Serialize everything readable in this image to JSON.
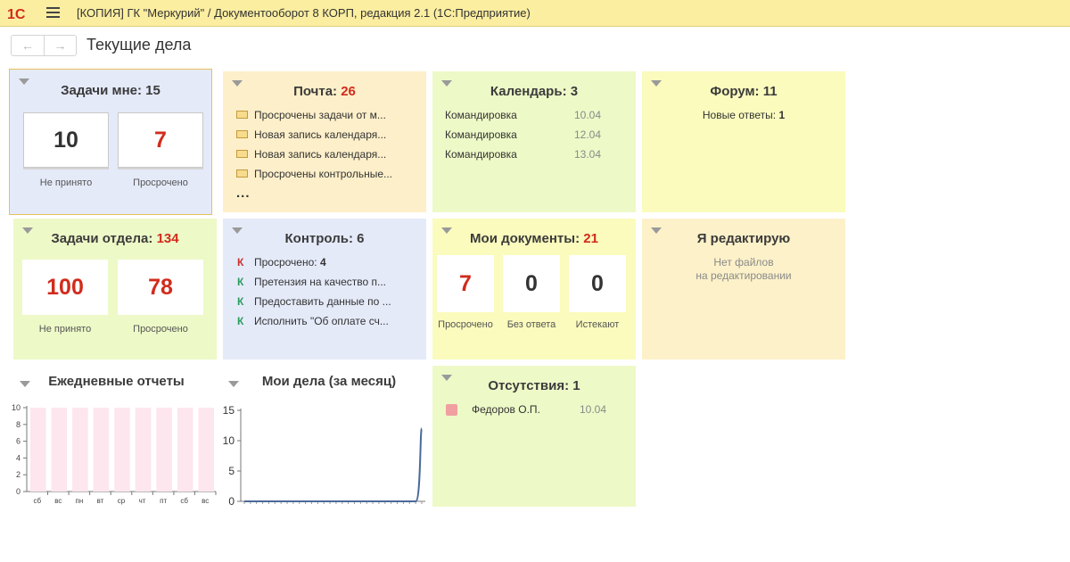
{
  "window": {
    "title": "[КОПИЯ] ГК \"Меркурий\" / Документооборот 8 КОРП, редакция 2.1  (1С:Предприятие)",
    "logo": "1С"
  },
  "page": {
    "title": "Текущие дела"
  },
  "tiles": {
    "tasks_me": {
      "title": "Задачи мне: ",
      "count": "15",
      "boxes": [
        {
          "value": "10",
          "label": "Не принято"
        },
        {
          "value": "7",
          "label": "Просрочено"
        }
      ]
    },
    "mail": {
      "title": "Почта: ",
      "count": "26",
      "items": [
        "Просрочены задачи от м...",
        "Новая запись календаря...",
        "Новая запись календаря...",
        "Просрочены контрольные..."
      ],
      "more": "..."
    },
    "calendar": {
      "title": "Календарь: 3",
      "items": [
        {
          "name": "Командировка",
          "date": "10.04"
        },
        {
          "name": "Командировка",
          "date": "12.04"
        },
        {
          "name": "Командировка",
          "date": "13.04"
        }
      ]
    },
    "forum": {
      "title": "Форум: 11",
      "label": "Новые ответы: ",
      "value": "1"
    },
    "tasks_dept": {
      "title": "Задачи отдела: ",
      "count": "134",
      "boxes": [
        {
          "value": "100",
          "label": "Не принято"
        },
        {
          "value": "78",
          "label": "Просрочено"
        }
      ]
    },
    "control": {
      "title": "Контроль: 6",
      "items": [
        {
          "mark": "К",
          "text": "Просрочено: ",
          "bold": "4",
          "color": "#c9302c"
        },
        {
          "mark": "К",
          "text": "Претензия на качество п...",
          "bold": "",
          "color": "#2a9d5c"
        },
        {
          "mark": "К",
          "text": "Предоставить данные по ...",
          "bold": "",
          "color": "#2a9d5c"
        },
        {
          "mark": "К",
          "text": "Исполнить \"Об оплате сч...",
          "bold": "",
          "color": "#2a9d5c"
        }
      ]
    },
    "my_docs": {
      "title": "Мои документы: ",
      "count": "21",
      "boxes": [
        {
          "value": "7",
          "label": "Просрочено"
        },
        {
          "value": "0",
          "label": "Без ответа"
        },
        {
          "value": "0",
          "label": "Истекают"
        }
      ]
    },
    "editing": {
      "title": "Я редактирую",
      "line1": "Нет файлов",
      "line2": "на редактировании"
    },
    "absences": {
      "title": "Отсутствия: 1",
      "items": [
        {
          "name": "Федоров О.П.",
          "date": "10.04",
          "color": "#f0a0a0"
        }
      ]
    }
  },
  "colors": {
    "blue_tile": "#e5eaf9",
    "orange_tile": "#fdefc9",
    "green_tile": "#edf9c7",
    "yellow_tile": "#fafbbd",
    "peach_tile": "#fdf1c9",
    "red": "#d12b1c"
  },
  "chart_data": [
    {
      "type": "bar",
      "title": "Ежедневные отчеты",
      "categories": [
        "сб",
        "вс",
        "пн",
        "вт",
        "ср",
        "чт",
        "пт",
        "сб",
        "вс"
      ],
      "values": [
        10,
        10,
        10,
        10,
        10,
        10,
        10,
        10,
        10
      ],
      "yticks": [
        0,
        2,
        4,
        6,
        8,
        10
      ],
      "ylim": [
        0,
        10
      ],
      "grid": false,
      "bar_color": "#fde6ee"
    },
    {
      "type": "line",
      "title": "Мои дела (за месяц)",
      "x": [
        0,
        1,
        2,
        3,
        4,
        5,
        6,
        7,
        8,
        9,
        10,
        11,
        12,
        13,
        14,
        15,
        16,
        17,
        18,
        19,
        20,
        21,
        22,
        23,
        24,
        25,
        26,
        27,
        28,
        29
      ],
      "values": [
        0,
        0,
        0,
        0,
        0,
        0,
        0,
        0,
        0,
        0,
        0,
        0,
        0,
        0,
        0,
        0,
        0,
        0,
        0,
        0,
        0,
        0,
        0,
        0,
        0,
        0,
        0,
        0,
        0,
        12
      ],
      "yticks": [
        0,
        5,
        10,
        15
      ],
      "ylim": [
        0,
        15
      ],
      "grid": false,
      "line_color": "#4a6a9a"
    }
  ]
}
